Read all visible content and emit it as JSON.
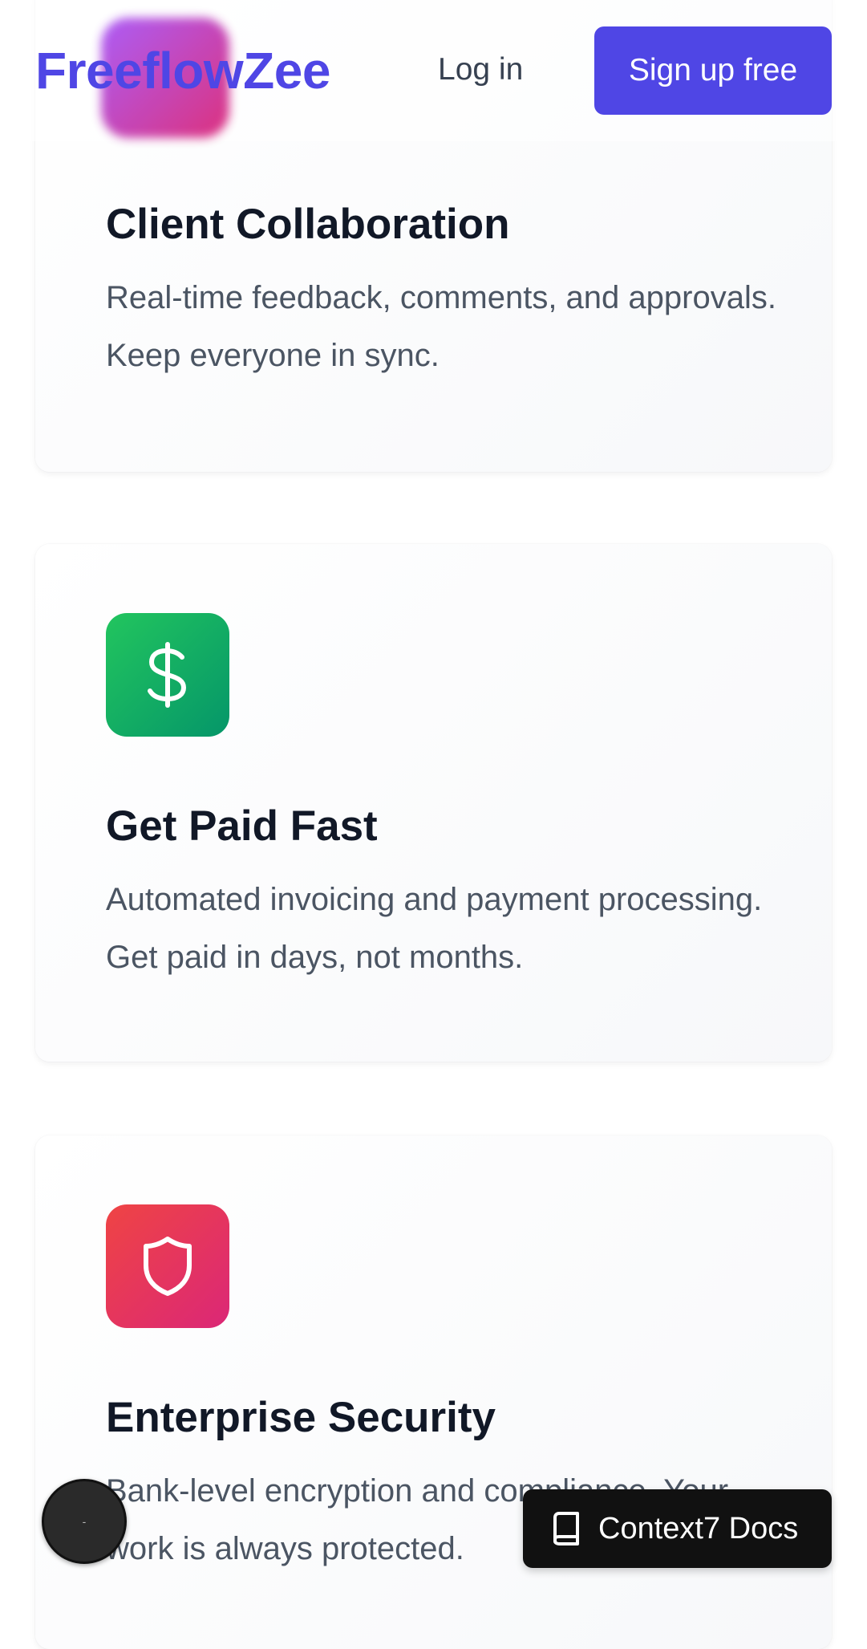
{
  "header": {
    "logo": "FreeflowZee",
    "login_label": "Log in",
    "signup_label": "Sign up free"
  },
  "features": [
    {
      "title": "Client Collaboration",
      "description": "Real-time feedback, comments, and approvals. Keep everyone in sync.",
      "icon": "gradient-purple-pink"
    },
    {
      "title": "Get Paid Fast",
      "description": "Automated invoicing and payment processing. Get paid in days, not months.",
      "icon": "dollar-icon"
    },
    {
      "title": "Enterprise Security",
      "description": "Bank-level encryption and compliance. Your work is always protected.",
      "icon": "shield-icon"
    }
  ],
  "widgets": {
    "docs_label": "Context7 Docs",
    "fab_label": "-"
  },
  "colors": {
    "brand": "#4f46e5",
    "heading": "#111827",
    "body_text": "#4b5563",
    "green_icon": "#16a34a",
    "red_icon": "#e11d48"
  }
}
